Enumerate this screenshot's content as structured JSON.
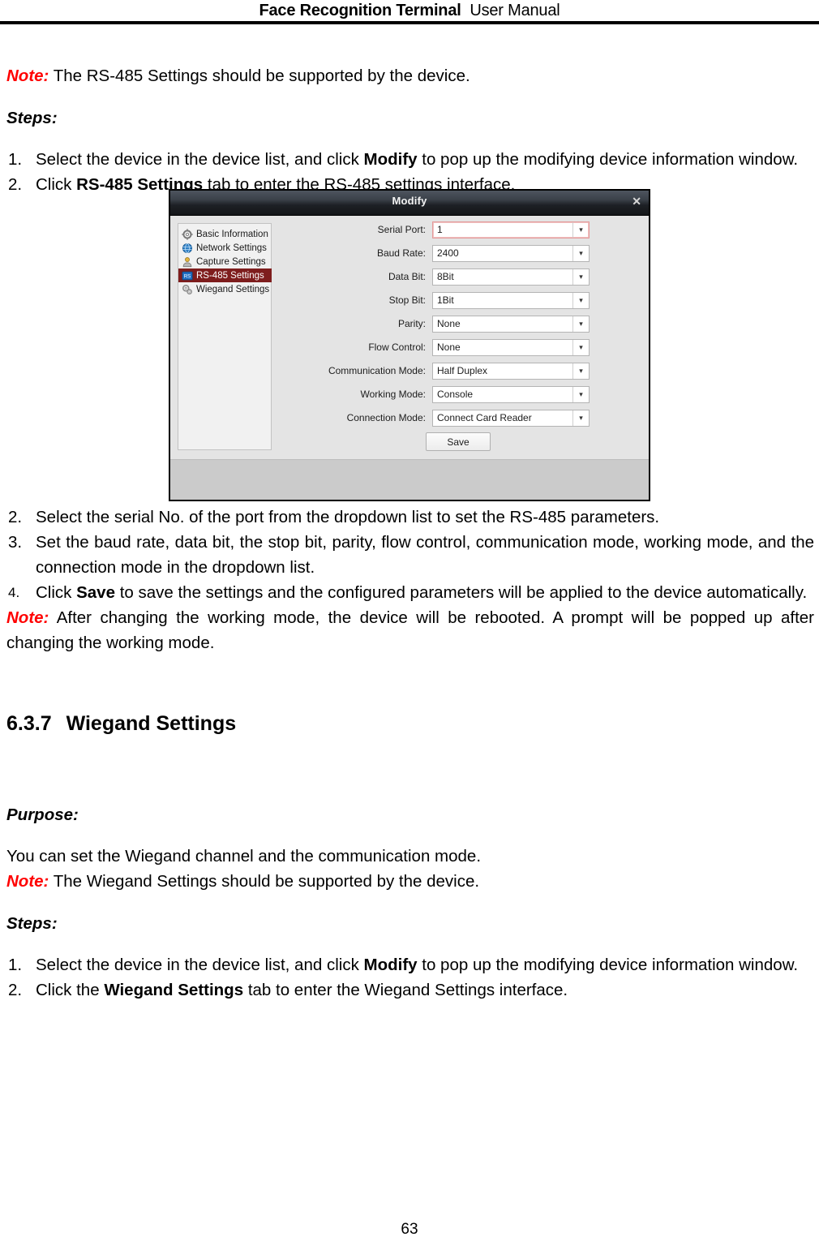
{
  "header": {
    "title_bold": "Face Recognition Terminal",
    "title_light": "User Manual"
  },
  "section_rs485": {
    "note_label": "Note:",
    "note_text": " The RS-485 Settings should be supported by the device.",
    "steps_label": "Steps:",
    "step1_num": "1.",
    "step1_a": "Select the device in the device list, and click ",
    "step1_bold": "Modify",
    "step1_b": " to pop up the modifying device information window.",
    "step2_num": "2.",
    "step2_a": "Click ",
    "step2_bold": "RS-485 Settings",
    "step2_b": " tab to enter the RS-485 settings interface."
  },
  "figure": {
    "dialog_title": "Modify",
    "close_icon": "close-icon",
    "nav": [
      {
        "label": "Basic Information",
        "icon": "gear-icon",
        "active": false
      },
      {
        "label": "Network Settings",
        "icon": "globe-icon",
        "active": false
      },
      {
        "label": "Capture Settings",
        "icon": "person-icon",
        "active": false
      },
      {
        "label": "RS-485 Settings",
        "icon": "rs485-badge-icon",
        "active": true
      },
      {
        "label": "Wiegand Settings",
        "icon": "gears-icon",
        "active": false
      }
    ],
    "fields": [
      {
        "label": "Serial Port:",
        "value": "1",
        "focused": true
      },
      {
        "label": "Baud Rate:",
        "value": "2400",
        "focused": false
      },
      {
        "label": "Data Bit:",
        "value": "8Bit",
        "focused": false
      },
      {
        "label": "Stop Bit:",
        "value": "1Bit",
        "focused": false
      },
      {
        "label": "Parity:",
        "value": "None",
        "focused": false
      },
      {
        "label": "Flow Control:",
        "value": "None",
        "focused": false
      },
      {
        "label": "Communication Mode:",
        "value": "Half Duplex",
        "focused": false
      },
      {
        "label": "Working Mode:",
        "value": "Console",
        "focused": false
      },
      {
        "label": "Connection Mode:",
        "value": "Connect Card Reader",
        "focused": false
      }
    ],
    "save_label": "Save"
  },
  "section_rs485_cont": {
    "step2_num": "2.",
    "step2_text": "Select the serial No. of the port from the dropdown list to set the RS-485 parameters.",
    "step3_num": "3.",
    "step3_text": "Set the baud rate, data bit, the stop bit, parity, flow control, communication mode, working mode, and the connection mode in the dropdown list.",
    "step4_num": "4.",
    "step4_a": "Click ",
    "step4_bold": "Save",
    "step4_b": " to save the settings and the configured parameters will be applied to the device automatically.",
    "note_label": "Note:",
    "note_text": " After changing the working mode, the device will be rebooted. A prompt will be popped up after changing the working mode."
  },
  "heading": {
    "number": "6.3.7",
    "title": "Wiegand Settings"
  },
  "section_wiegand": {
    "purpose_label": "Purpose:",
    "purpose_text": "You can set the Wiegand channel and the communication mode.",
    "note_label": "Note:",
    "note_text": " The Wiegand Settings should be supported by the device.",
    "steps_label": "Steps:",
    "step1_num": "1.",
    "step1_a": "Select the device in the device list, and click ",
    "step1_bold": "Modify",
    "step1_b": " to pop up the modifying device information window.",
    "step2_num": "2.",
    "step2_a": "Click the ",
    "step2_bold": "Wiegand Settings",
    "step2_b": " tab to enter the Wiegand Settings interface."
  },
  "footer": {
    "page_number": "63"
  }
}
